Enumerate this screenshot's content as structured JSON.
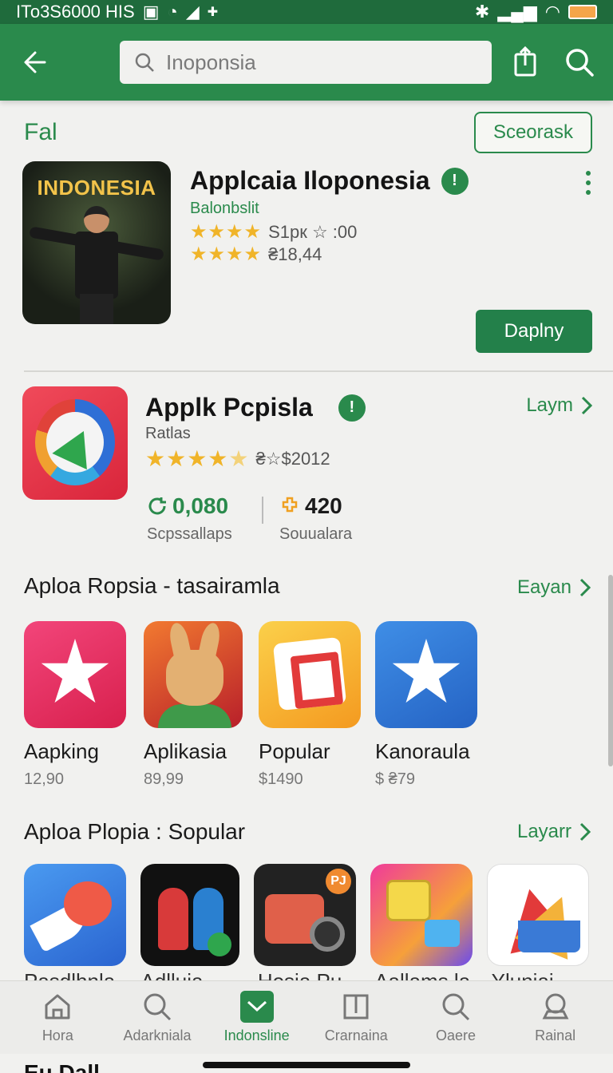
{
  "status": {
    "left_text": "IТо3S6000 HIS",
    "battery_color": "#f5a54a"
  },
  "appbar": {
    "back_icon": "arrow-left-icon",
    "search_value": "Inoponsia",
    "share_icon": "share-icon",
    "search_icon": "search-icon",
    "color": "#2a8a4c"
  },
  "featured": {
    "heading": "Fal",
    "button": "Sceorask",
    "banner_text": "INDONESIA",
    "title": "Applcaia Iloponesia",
    "developer": "Balonbslit",
    "rating1_text": "S1pк ☆ :00",
    "rating2_text": "₴18,44",
    "cta": "Daplny"
  },
  "app2": {
    "title": "Applk Pcpisla",
    "subtitle": "Ratlas",
    "rating_text": "₴☆$2012",
    "link": "Laym",
    "stat1_num": "0,080",
    "stat1_label": "Scpssallaps",
    "stat2_num": "420",
    "stat2_label": "Souualara"
  },
  "section1": {
    "title": "Aploa Ropsia - tasairamla",
    "link": "Eayan",
    "apps": [
      {
        "name": "Aapking",
        "price": "12,90"
      },
      {
        "name": "Aplikasia",
        "price": "89,99"
      },
      {
        "name": "Popular",
        "price": "$1490"
      },
      {
        "name": "Kanoraula",
        "price": "$ ₴79"
      }
    ]
  },
  "section2": {
    "title": "Aploa Plopia : Sopular",
    "link": "Layarr",
    "badge": "PJ",
    "peek_names": [
      "Pasdlhnla",
      "Adlluia",
      "Hosia Pu",
      "Aallams la",
      "Yluniai"
    ]
  },
  "bottom_nav": [
    {
      "label": "Hora",
      "icon": "home-icon"
    },
    {
      "label": "Adarkniala",
      "icon": "search-icon"
    },
    {
      "label": "Indonsline",
      "icon": "check-icon"
    },
    {
      "label": "Crarnaina",
      "icon": "window-icon"
    },
    {
      "label": "Oaere",
      "icon": "search-icon"
    },
    {
      "label": "Rainal",
      "icon": "account-icon"
    }
  ],
  "footer_peek": "Eu Dall"
}
